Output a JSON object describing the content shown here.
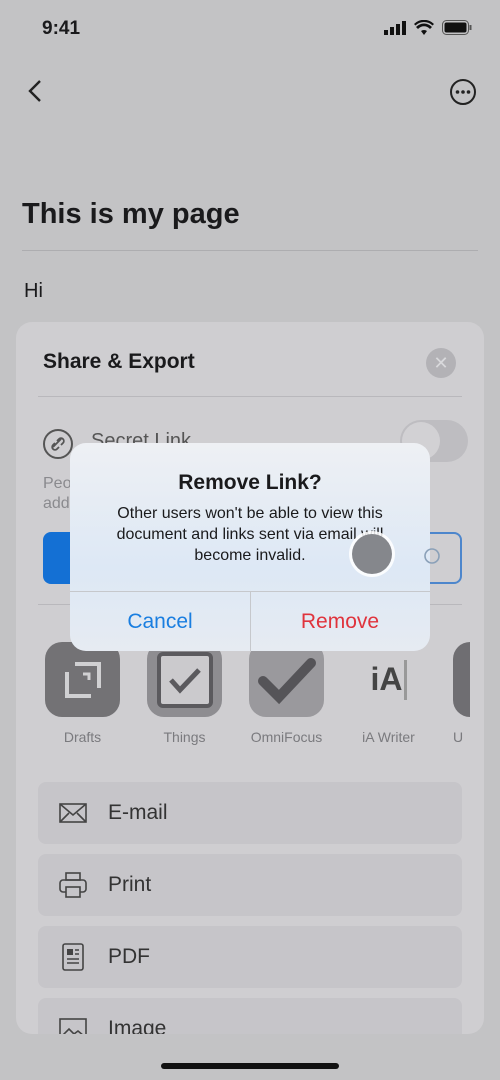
{
  "status": {
    "time": "9:41"
  },
  "page": {
    "title": "This is my page",
    "body": "Hi"
  },
  "sheet": {
    "title": "Share & Export",
    "secret_link_label": "Secret Link",
    "desc_line1": "Peo",
    "desc_line2": "add",
    "apps": [
      {
        "label": "Drafts",
        "icon": "drafts-icon"
      },
      {
        "label": "Things",
        "icon": "things-icon"
      },
      {
        "label": "OmniFocus",
        "icon": "omnifocus-icon"
      },
      {
        "label": "iA Writer",
        "icon": "ia-writer-icon",
        "glyph": "iA"
      },
      {
        "label": "U",
        "icon": "ulysses-icon"
      }
    ],
    "rows": [
      {
        "label": "E-mail",
        "icon": "envelope-icon"
      },
      {
        "label": "Print",
        "icon": "printer-icon"
      },
      {
        "label": "PDF",
        "icon": "pdf-icon"
      },
      {
        "label": "Image",
        "icon": "image-icon"
      }
    ]
  },
  "alert": {
    "title": "Remove Link?",
    "message": "Other users won't be able to view this document and links sent via email will become invalid.",
    "cancel": "Cancel",
    "remove": "Remove"
  },
  "colors": {
    "accent": "#1a7ee0",
    "destructive": "#e0333c"
  }
}
